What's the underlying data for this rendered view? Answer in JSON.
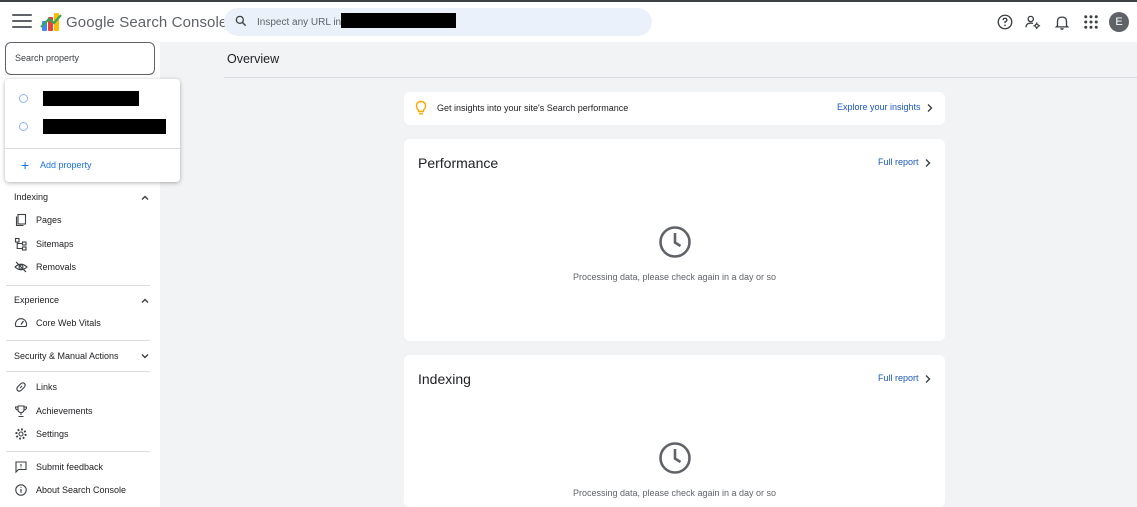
{
  "header": {
    "app_title": "Google Search Console",
    "url_placeholder": "Inspect any URL in",
    "avatar_letter": "E"
  },
  "property_search": {
    "placeholder": "Search property",
    "add_property_label": "Add property"
  },
  "sidebar": {
    "sections": [
      {
        "label": "Indexing",
        "items": [
          "Pages",
          "Sitemaps",
          "Removals"
        ]
      },
      {
        "label": "Experience",
        "items": [
          "Core Web Vitals"
        ]
      },
      {
        "label": "Security & Manual Actions",
        "items": []
      }
    ],
    "links": [
      "Links",
      "Achievements",
      "Settings"
    ],
    "footer": [
      "Submit feedback",
      "About Search Console"
    ]
  },
  "main": {
    "title": "Overview",
    "insight_text": "Get insights into your site's Search performance",
    "insight_link": "Explore your insights",
    "cards": [
      {
        "title": "Performance",
        "link": "Full report",
        "message": "Processing data, please check again in a day or so"
      },
      {
        "title": "Indexing",
        "link": "Full report",
        "message": "Processing data, please check again in a day or so"
      }
    ]
  },
  "colors": {
    "accent": "#1a73e8",
    "link": "#1a56c4",
    "bulb": "#f9ab00"
  }
}
